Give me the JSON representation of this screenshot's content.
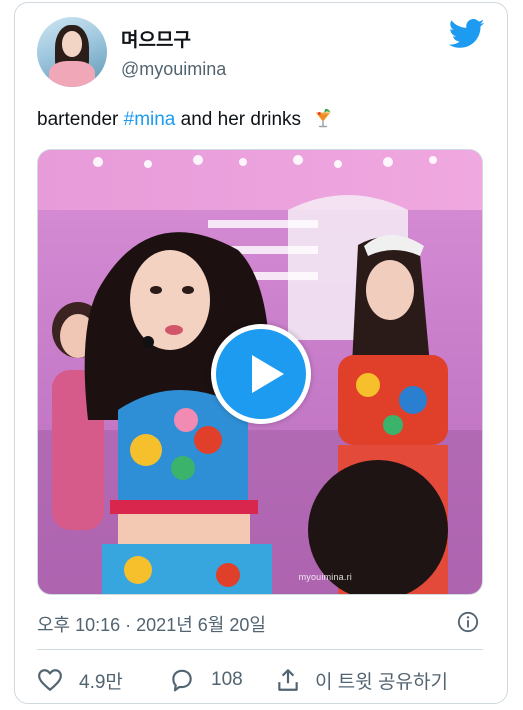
{
  "author": {
    "display_name": "며으므구",
    "handle": "@myouimina"
  },
  "tweet": {
    "text_prefix": "bartender ",
    "hashtag": "#mina",
    "text_suffix": " and her drinks",
    "emoji": "tropical-drink"
  },
  "media": {
    "type": "video",
    "watermark": "myouimina.ri"
  },
  "timestamp": "오후 10:16 · 2021년 6월 20일",
  "actions": {
    "like_count": "4.9만",
    "reply_count": "108",
    "share_label": "이 트윗 공유하기"
  },
  "colors": {
    "accent": "#1d9bf0",
    "secondary_text": "#536471",
    "border": "#cfd9de"
  },
  "icons": [
    "twitter-bird-icon",
    "drink-emoji-icon",
    "play-icon",
    "info-icon",
    "heart-icon",
    "reply-bubble-icon",
    "share-icon"
  ]
}
